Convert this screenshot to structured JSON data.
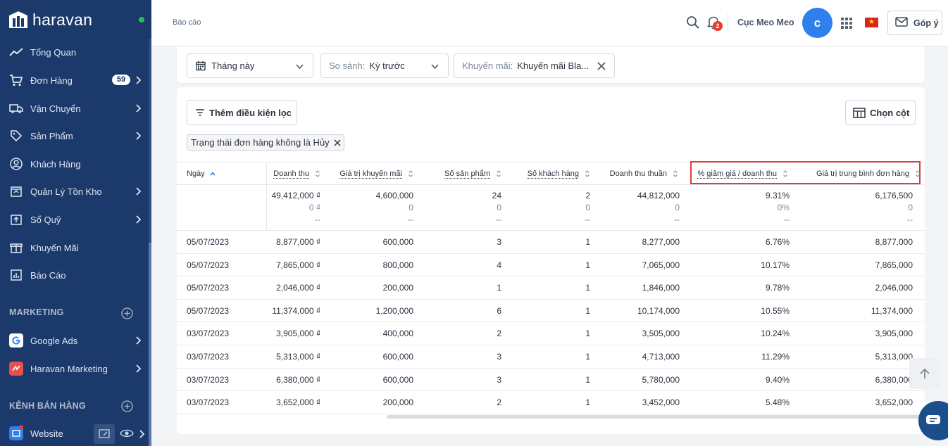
{
  "sidebar": {
    "brand": "haravan",
    "items": [
      {
        "label": "Tổng Quan",
        "icon": "trend-line-icon"
      },
      {
        "label": "Đơn Hàng",
        "icon": "cart-icon",
        "badge": "59"
      },
      {
        "label": "Vận Chuyển",
        "icon": "truck-icon"
      },
      {
        "label": "Sản Phẩm",
        "icon": "tag-icon"
      },
      {
        "label": "Khách Hàng",
        "icon": "user-circle-icon"
      },
      {
        "label": "Quản Lý Tồn Kho",
        "icon": "inventory-box-icon"
      },
      {
        "label": "Sổ Quỹ",
        "icon": "cashbook-icon"
      },
      {
        "label": "Khuyến Mãi",
        "icon": "gift-icon"
      },
      {
        "label": "Báo Cáo",
        "icon": "bar-chart-icon"
      }
    ],
    "marketing_title": "MARKETING",
    "marketing_items": [
      {
        "label": "Google Ads",
        "icon": "google-icon"
      },
      {
        "label": "Haravan Marketing",
        "icon": "haravan-marketing-icon"
      }
    ],
    "channels_title": "KÊNH BÁN HÀNG",
    "channel_items": [
      {
        "label": "Website",
        "icon": "website-icon"
      }
    ]
  },
  "header": {
    "breadcrumb": "Báo cáo",
    "notification_count": "2",
    "shop_name": "Cục Meo Meo",
    "avatar_letter": "c",
    "feedback_label": "Góp ý"
  },
  "filters": {
    "period": "Tháng này",
    "compare_label": "So sánh:",
    "compare_value": "Kỳ trước",
    "promo_label": "Khuyến mãi:",
    "promo_value": "Khuyến mãi Bla..."
  },
  "toolbar": {
    "add_filter": "Thêm điều kiện lọc",
    "choose_columns": "Chọn cột",
    "active_filter": "Trạng thái đơn hàng không là Hủy"
  },
  "table": {
    "headers": [
      "Ngày",
      "Doanh thu",
      "Giá trị khuyến mãi",
      "Số sản phẩm",
      "Số khách hàng",
      "Doanh thu thuần",
      "% giảm giá / doanh thu",
      "Giá trị trung bình đơn hàng"
    ],
    "summary": [
      [
        "49,412,000 ₫",
        "0 ₫",
        "--"
      ],
      [
        "4,600,000",
        "0",
        "--"
      ],
      [
        "24",
        "0",
        "--"
      ],
      [
        "2",
        "0",
        "--"
      ],
      [
        "44,812,000",
        "0",
        "--"
      ],
      [
        "9.31%",
        "0%",
        "--"
      ],
      [
        "6,176,500",
        "0",
        "--"
      ]
    ],
    "rows": [
      [
        "05/07/2023",
        "8,877,000 ₫",
        "600,000",
        "3",
        "1",
        "8,277,000",
        "6.76%",
        "8,877,000"
      ],
      [
        "05/07/2023",
        "7,865,000 ₫",
        "800,000",
        "4",
        "1",
        "7,065,000",
        "10.17%",
        "7,865,000"
      ],
      [
        "05/07/2023",
        "2,046,000 ₫",
        "200,000",
        "1",
        "1",
        "1,846,000",
        "9.78%",
        "2,046,000"
      ],
      [
        "05/07/2023",
        "11,374,000 ₫",
        "1,200,000",
        "6",
        "1",
        "10,174,000",
        "10.55%",
        "11,374,000"
      ],
      [
        "03/07/2023",
        "3,905,000 ₫",
        "400,000",
        "2",
        "1",
        "3,505,000",
        "10.24%",
        "3,905,000"
      ],
      [
        "03/07/2023",
        "5,313,000 ₫",
        "600,000",
        "3",
        "1",
        "4,713,000",
        "11.29%",
        "5,313,000"
      ],
      [
        "03/07/2023",
        "6,380,000 ₫",
        "600,000",
        "3",
        "1",
        "5,780,000",
        "9.40%",
        "6,380,000"
      ],
      [
        "03/07/2023",
        "3,652,000 ₫",
        "200,000",
        "2",
        "1",
        "3,452,000",
        "5.48%",
        "3,652,000"
      ]
    ]
  },
  "colors": {
    "sidebar_bg": "#1b3a6b",
    "accent": "#2f80ed",
    "highlight": "#e03c3c"
  }
}
